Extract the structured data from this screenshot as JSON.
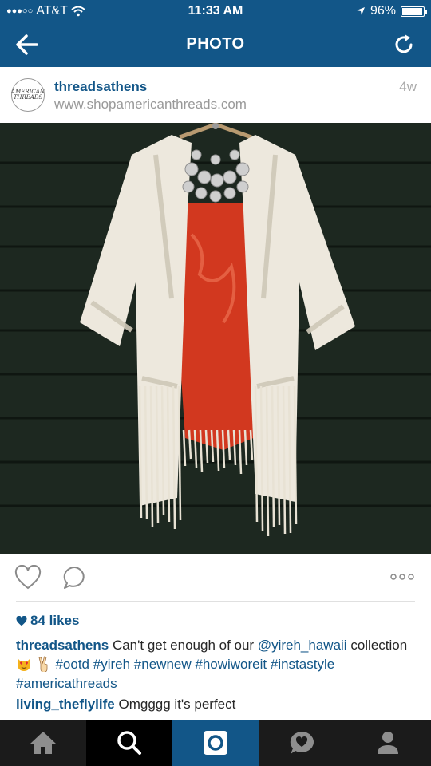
{
  "status_bar": {
    "carrier": "AT&T",
    "time": "11:33 AM",
    "battery_percent": "96%",
    "battery_level": 0.96
  },
  "nav": {
    "title": "PHOTO"
  },
  "post": {
    "username": "threadsathens",
    "location": "www.shopamericanthreads.com",
    "timestamp": "4w",
    "avatar_text": "AMERICAN THREADS",
    "likes": "84 likes",
    "caption": {
      "username": "threadsathens",
      "text1": "Can't get enough of our",
      "mention": "@yireh_hawaii",
      "text2": "collection",
      "tags": [
        "#ootd",
        "#yireh",
        "#newnew",
        "#howiworeit",
        "#instastyle",
        "#americathreads"
      ]
    },
    "comment": {
      "username": "living_theflylife",
      "text": "Omgggg it's perfect"
    }
  },
  "colors": {
    "brand": "#125688",
    "tab_bar": "#1b1b1b"
  },
  "tabs": [
    "home-icon",
    "search-icon",
    "camera-icon",
    "activity-icon",
    "profile-icon"
  ]
}
